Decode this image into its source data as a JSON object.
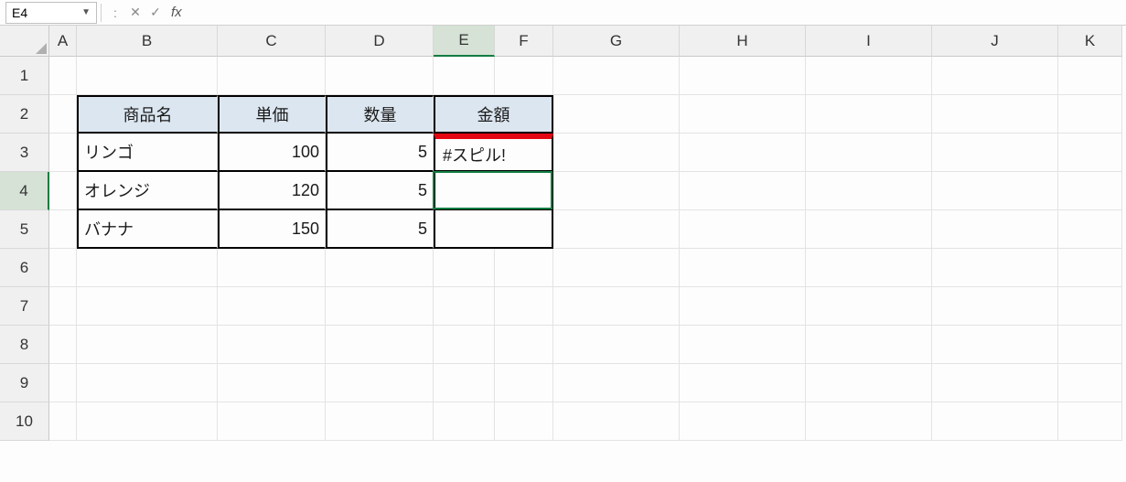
{
  "name_box": {
    "value": "E4"
  },
  "formula_bar": {
    "dots": ":",
    "cancel": "✕",
    "enter": "✓",
    "fx_label": "fx",
    "formula": ""
  },
  "columns": [
    "A",
    "B",
    "C",
    "D",
    "E",
    "F",
    "G",
    "H",
    "I",
    "J",
    "K"
  ],
  "rows": [
    "1",
    "2",
    "3",
    "4",
    "5",
    "6",
    "7",
    "8",
    "9",
    "10"
  ],
  "table": {
    "headers": {
      "b2": "商品名",
      "c2": "単価",
      "d2": "数量",
      "ef2": "金額"
    },
    "body": [
      {
        "name": "リンゴ",
        "unit": "100",
        "qty": "5",
        "amount": "#スピル!"
      },
      {
        "name": "オレンジ",
        "unit": "120",
        "qty": "5",
        "amount": ""
      },
      {
        "name": "バナナ",
        "unit": "150",
        "qty": "5",
        "amount": ""
      }
    ]
  },
  "active_cell": "E4"
}
